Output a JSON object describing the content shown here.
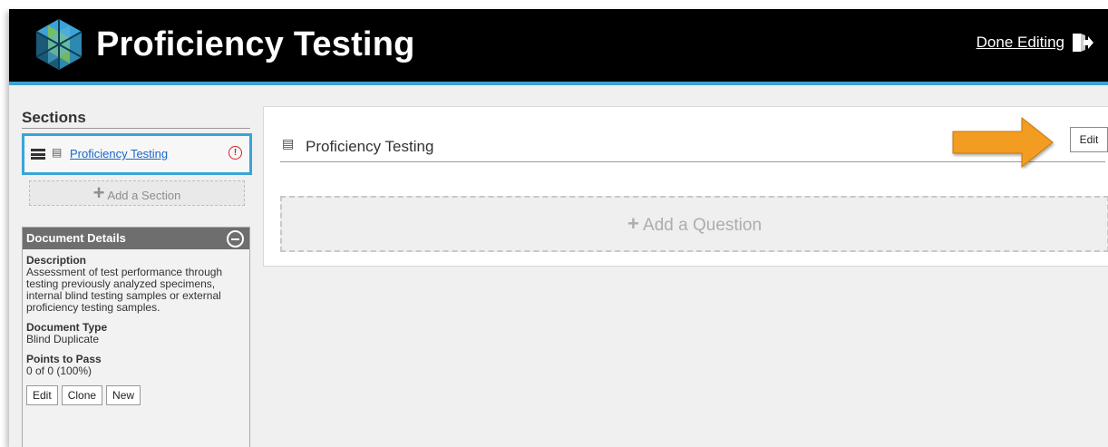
{
  "header": {
    "title": "Proficiency Testing",
    "done_editing_label": "Done Editing"
  },
  "sidebar": {
    "sections_heading": "Sections",
    "sections": [
      {
        "label": "Proficiency Testing",
        "status_icon": "alert-icon"
      }
    ],
    "add_section_label": "Add a Section"
  },
  "document_details": {
    "heading": "Document Details",
    "description_label": "Description",
    "description_text": "Assessment of test performance through testing previously analyzed specimens, internal blind testing samples or external proficiency testing samples.",
    "doc_type_label": "Document Type",
    "doc_type_value": "Blind Duplicate",
    "points_label": "Points to Pass",
    "points_value": "0 of 0 (100%)",
    "buttons": {
      "edit": "Edit",
      "clone": "Clone",
      "new": "New"
    }
  },
  "main": {
    "section_title": "Proficiency Testing",
    "edit_label": "Edit",
    "add_question_label": "Add a Question"
  },
  "colors": {
    "header_bg": "#000000",
    "accent": "#3ba3d8",
    "arrow": "#f39c23",
    "link": "#1a66cc",
    "alert": "#d62020"
  }
}
